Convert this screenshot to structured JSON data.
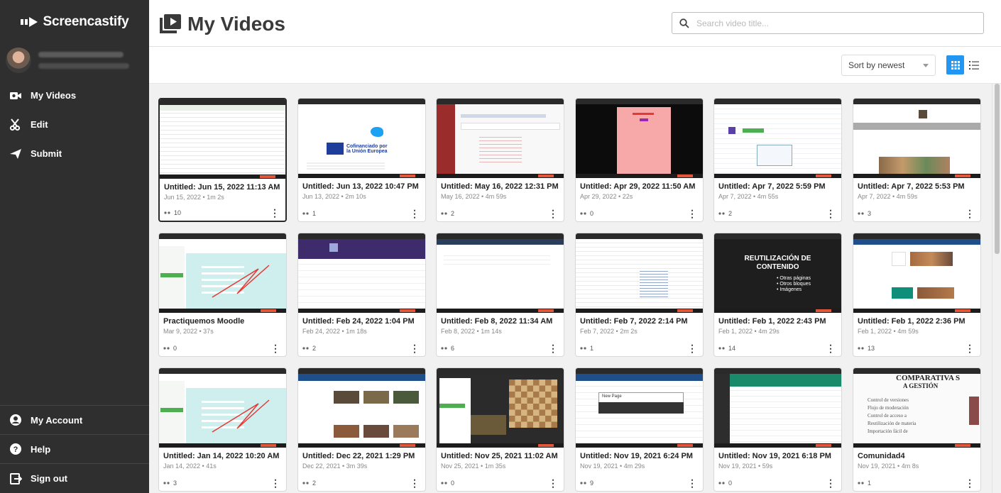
{
  "brand": {
    "name": "Screencastify"
  },
  "nav": {
    "my_videos": "My Videos",
    "edit": "Edit",
    "submit": "Submit"
  },
  "bottom_nav": {
    "account": "My Account",
    "help": "Help",
    "sign_out": "Sign out"
  },
  "header": {
    "title": "My Videos",
    "search_placeholder": "Search video title..."
  },
  "toolbar": {
    "sort_label": "Sort by newest",
    "active_view": "grid"
  },
  "colors": {
    "sidebar": "#2f2f2f",
    "accent": "#2196f3"
  },
  "videos": [
    {
      "title": "Untitled: Jun 15, 2022 11:13 AM",
      "meta": "Jun 15, 2022 • 1m 2s",
      "views": "10",
      "thumb": "spreadsheet"
    },
    {
      "title": "Untitled: Jun 13, 2022 10:47 PM",
      "meta": "Jun 13, 2022 • 2m 10s",
      "views": "1",
      "thumb": "eu"
    },
    {
      "title": "Untitled: May 16, 2022 12:31 PM",
      "meta": "May 16, 2022 • 4m 59s",
      "views": "2",
      "thumb": "redsidebar"
    },
    {
      "title": "Untitled: Apr 29, 2022 11:50 AM",
      "meta": "Apr 29, 2022 • 22s",
      "views": "0",
      "thumb": "pink"
    },
    {
      "title": "Untitled: Apr 7, 2022 5:59 PM",
      "meta": "Apr 7, 2022 • 4m 55s",
      "views": "2",
      "thumb": "web"
    },
    {
      "title": "Untitled: Apr 7, 2022 5:53 PM",
      "meta": "Apr 7, 2022 • 4m 59s",
      "views": "3",
      "thumb": "webphoto"
    },
    {
      "title": "Practiquemos Moodle",
      "meta": "Mar 9, 2022 • 37s",
      "views": "0",
      "thumb": "diagram"
    },
    {
      "title": "Untitled: Feb 24, 2022 1:04 PM",
      "meta": "Feb 24, 2022 • 1m 18s",
      "views": "2",
      "thumb": "purple"
    },
    {
      "title": "Untitled: Feb 8, 2022 11:34 AM",
      "meta": "Feb 8, 2022 • 1m 14s",
      "views": "6",
      "thumb": "blank"
    },
    {
      "title": "Untitled: Feb 7, 2022 2:14 PM",
      "meta": "Feb 7, 2022 • 2m 2s",
      "views": "1",
      "thumb": "doc"
    },
    {
      "title": "Untitled: Feb 1, 2022 2:43 PM",
      "meta": "Feb 1, 2022 • 4m 29s",
      "views": "14",
      "thumb": "slide",
      "slide": {
        "heading": "REUTILIZACIÓN DE CONTENIDO",
        "bullets": [
          "Otras páginas",
          "Otros bloques",
          "Imágenes"
        ]
      }
    },
    {
      "title": "Untitled: Feb 1, 2022 2:36 PM",
      "meta": "Feb 1, 2022 • 4m 59s",
      "views": "13",
      "thumb": "moodlecourse"
    },
    {
      "title": "Untitled: Jan 14, 2022 10:20 AM",
      "meta": "Jan 14, 2022 • 41s",
      "views": "3",
      "thumb": "diagram"
    },
    {
      "title": "Untitled: Dec 22, 2021 1:29 PM",
      "meta": "Dec 22, 2021 • 3m 39s",
      "views": "2",
      "thumb": "photogrid"
    },
    {
      "title": "Untitled: Nov 25, 2021 11:02 AM",
      "meta": "Nov 25, 2021 • 1m 35s",
      "views": "0",
      "thumb": "chess"
    },
    {
      "title": "Untitled: Nov 19, 2021 6:24 PM",
      "meta": "Nov 19, 2021 • 4m 29s",
      "views": "9",
      "thumb": "dialog",
      "dialog_text": "New Page"
    },
    {
      "title": "Untitled: Nov 19, 2021 6:18 PM",
      "meta": "Nov 19, 2021 • 59s",
      "views": "0",
      "thumb": "green"
    },
    {
      "title": "Comunidad4",
      "meta": "Nov 19, 2021 • 4m 8s",
      "views": "1",
      "thumb": "comparativa",
      "comparativa": {
        "heading": "COMPARATIVA S",
        "sub": "A GESTIÓN",
        "lines": [
          "Control de versiones",
          "Flujo de moderación",
          "Control de acceso a",
          "Reutilización de materia",
          "Importación fácil de"
        ]
      }
    }
  ]
}
